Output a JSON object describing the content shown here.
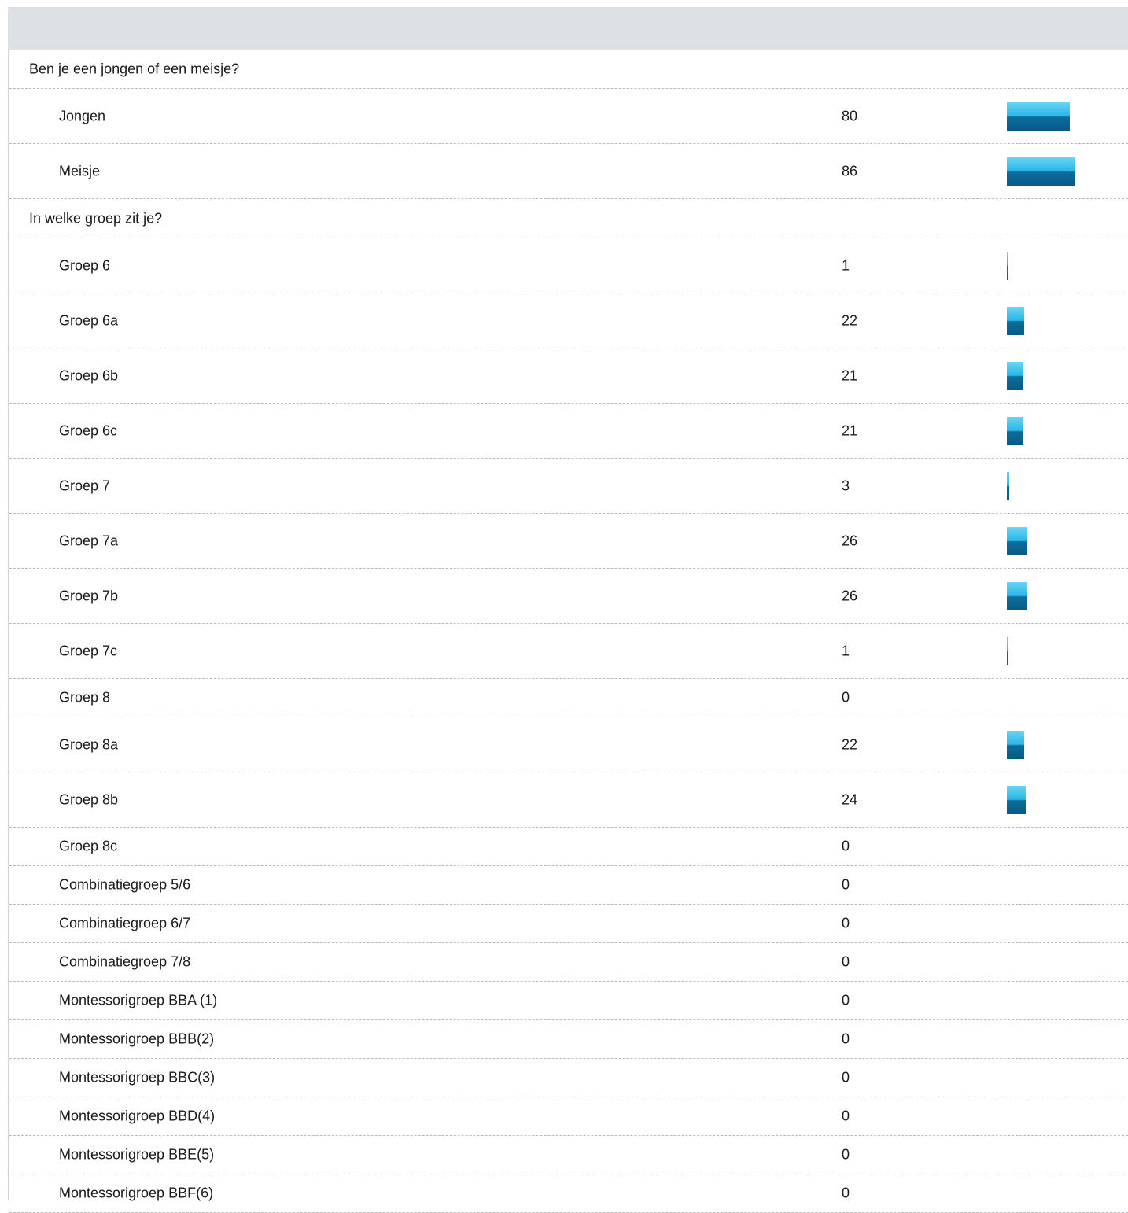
{
  "bar_max": 86,
  "colors": {
    "header_band": "#dde0e4",
    "bar_top": "#2ab6e8",
    "bar_bottom": "#075a86",
    "divider": "#b8bcc2"
  },
  "questions": [
    {
      "title": "Ben je een jongen of een meisje?",
      "options": [
        {
          "label": "Jongen",
          "count": "80",
          "value": 80
        },
        {
          "label": "Meisje",
          "count": "86",
          "value": 86
        }
      ]
    },
    {
      "title": "In welke groep zit je?",
      "options": [
        {
          "label": "Groep 6",
          "count": "1",
          "value": 1
        },
        {
          "label": "Groep 6a",
          "count": "22",
          "value": 22
        },
        {
          "label": "Groep 6b",
          "count": "21",
          "value": 21
        },
        {
          "label": "Groep 6c",
          "count": "21",
          "value": 21
        },
        {
          "label": "Groep 7",
          "count": "3",
          "value": 3
        },
        {
          "label": "Groep 7a",
          "count": "26",
          "value": 26
        },
        {
          "label": "Groep 7b",
          "count": "26",
          "value": 26
        },
        {
          "label": "Groep 7c",
          "count": "1",
          "value": 1
        },
        {
          "label": "Groep 8",
          "count": "0",
          "value": 0
        },
        {
          "label": "Groep 8a",
          "count": "22",
          "value": 22
        },
        {
          "label": "Groep 8b",
          "count": "24",
          "value": 24
        },
        {
          "label": "Groep 8c",
          "count": "0",
          "value": 0
        },
        {
          "label": "Combinatiegroep 5/6",
          "count": "0",
          "value": 0
        },
        {
          "label": "Combinatiegroep 6/7",
          "count": "0",
          "value": 0
        },
        {
          "label": "Combinatiegroep 7/8",
          "count": "0",
          "value": 0
        },
        {
          "label": "Montessorigroep BBA (1)",
          "count": "0",
          "value": 0
        },
        {
          "label": "Montessorigroep BBB(2)",
          "count": "0",
          "value": 0
        },
        {
          "label": "Montessorigroep BBC(3)",
          "count": "0",
          "value": 0
        },
        {
          "label": "Montessorigroep BBD(4)",
          "count": "0",
          "value": 0
        },
        {
          "label": "Montessorigroep BBE(5)",
          "count": "0",
          "value": 0
        },
        {
          "label": "Montessorigroep BBF(6)",
          "count": "0",
          "value": 0
        }
      ]
    }
  ]
}
